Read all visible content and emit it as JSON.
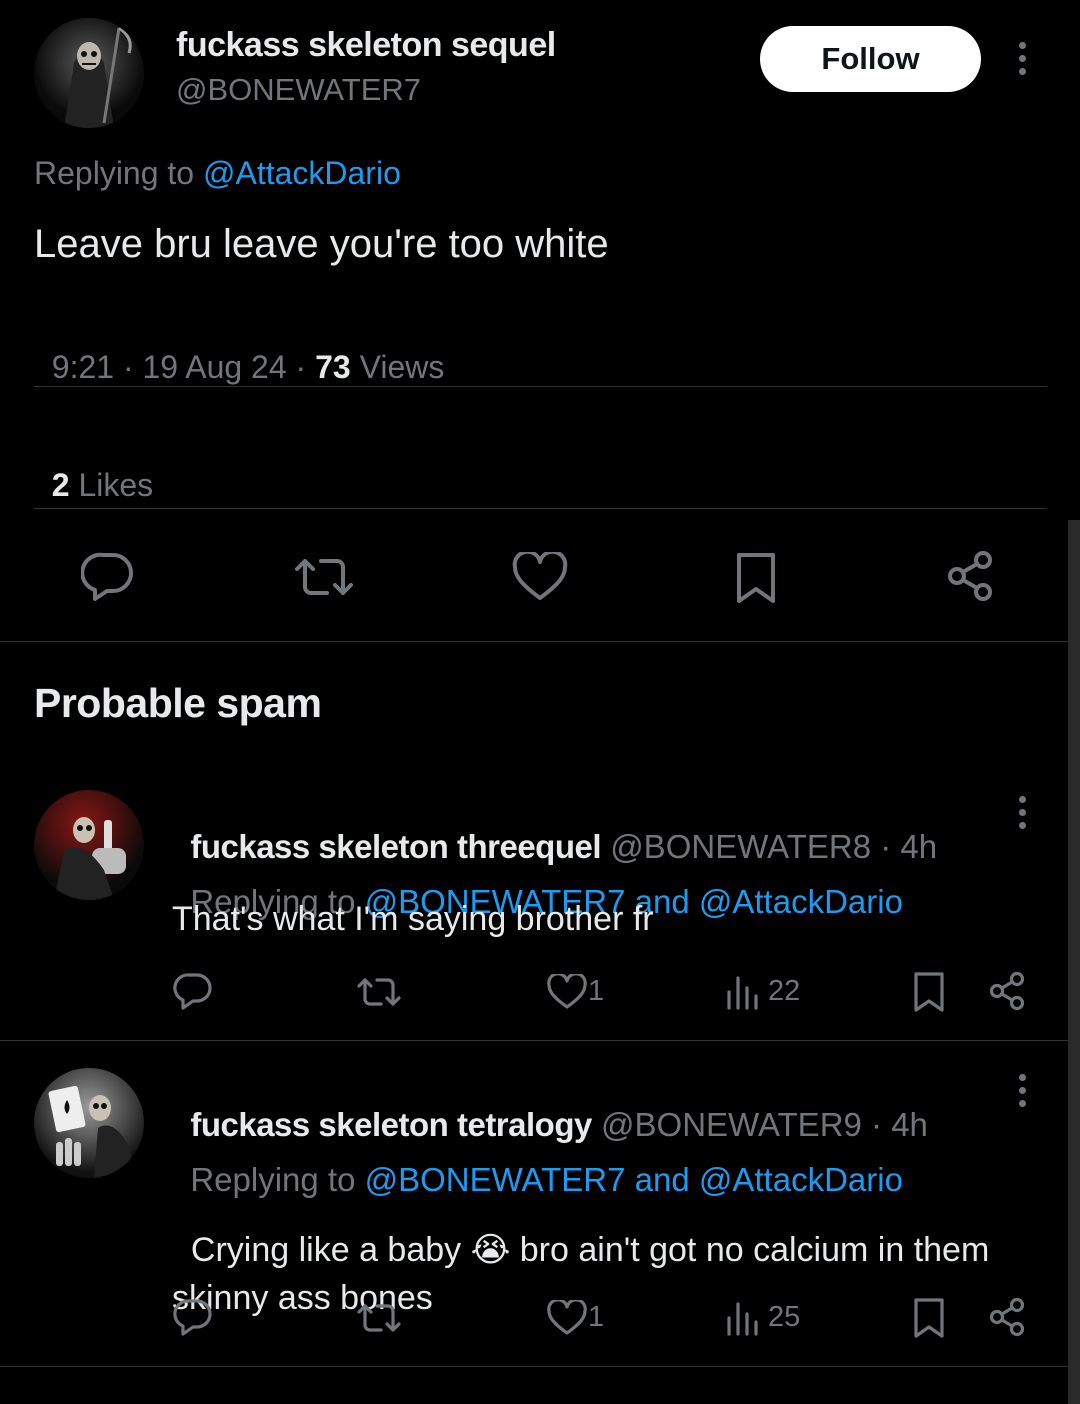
{
  "main_tweet": {
    "display_name": "fuckass skeleton sequel",
    "handle": "@BONEWATER7",
    "follow_label": "Follow",
    "replying_prefix": "Replying to ",
    "replying_to": "@AttackDario",
    "text": "Leave bru leave you're too white",
    "time": "9:21",
    "sep1": " · ",
    "date": "19 Aug 24",
    "sep2": " · ",
    "views_count": "73",
    "views_label": " Views",
    "likes_count": "2",
    "likes_label": " Likes"
  },
  "section_title": "Probable spam",
  "replies": [
    {
      "display_name": "fuckass skeleton threequel",
      "handle": "@BONEWATER8",
      "time_sep": " · ",
      "time": "4h",
      "replying_prefix": "Replying to ",
      "replying_to": "@BONEWATER7 and @AttackDario",
      "text": "That's what I'm saying brother fr",
      "likes": "1",
      "views": "22"
    },
    {
      "display_name": "fuckass skeleton tetralogy",
      "handle": "@BONEWATER9",
      "time_sep": " · ",
      "time": "4h",
      "replying_prefix": "Replying to ",
      "replying_to": "@BONEWATER7 and @AttackDario",
      "text_part1": "Crying like a baby ",
      "emoji": "😭",
      "text_part2": " bro ain't got no calcium in them",
      "text_line2": "skinny ass bones",
      "likes": "1",
      "views": "25"
    }
  ],
  "colors": {
    "background": "#000000",
    "text": "#e7e9ea",
    "secondary": "#71767b",
    "link": "#1d9bf0",
    "divider": "#2f3336"
  },
  "icons": [
    "reply-icon",
    "retweet-icon",
    "like-icon",
    "bookmark-icon",
    "share-icon",
    "views-icon",
    "more-icon"
  ]
}
